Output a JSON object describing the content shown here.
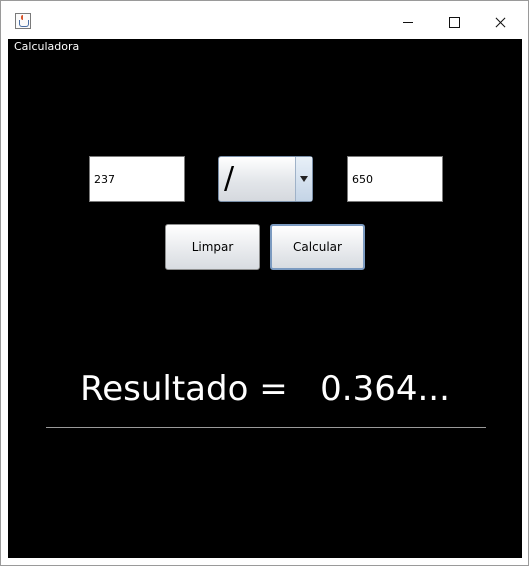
{
  "window": {
    "title_icon": "java-cup-icon",
    "controls": [
      "minimize-icon",
      "maximize-icon",
      "close-icon"
    ]
  },
  "form": {
    "title": "Calculadora",
    "operand_a": "237",
    "operator": "/",
    "operand_b": "650",
    "clear_label": "Limpar",
    "calc_label": "Calcular",
    "result_label": "Resultado =",
    "result_value": "0.364..."
  },
  "colors": {
    "background": "#000000",
    "result_text": "#ffffff",
    "focus_border": "#7b9ac0"
  }
}
